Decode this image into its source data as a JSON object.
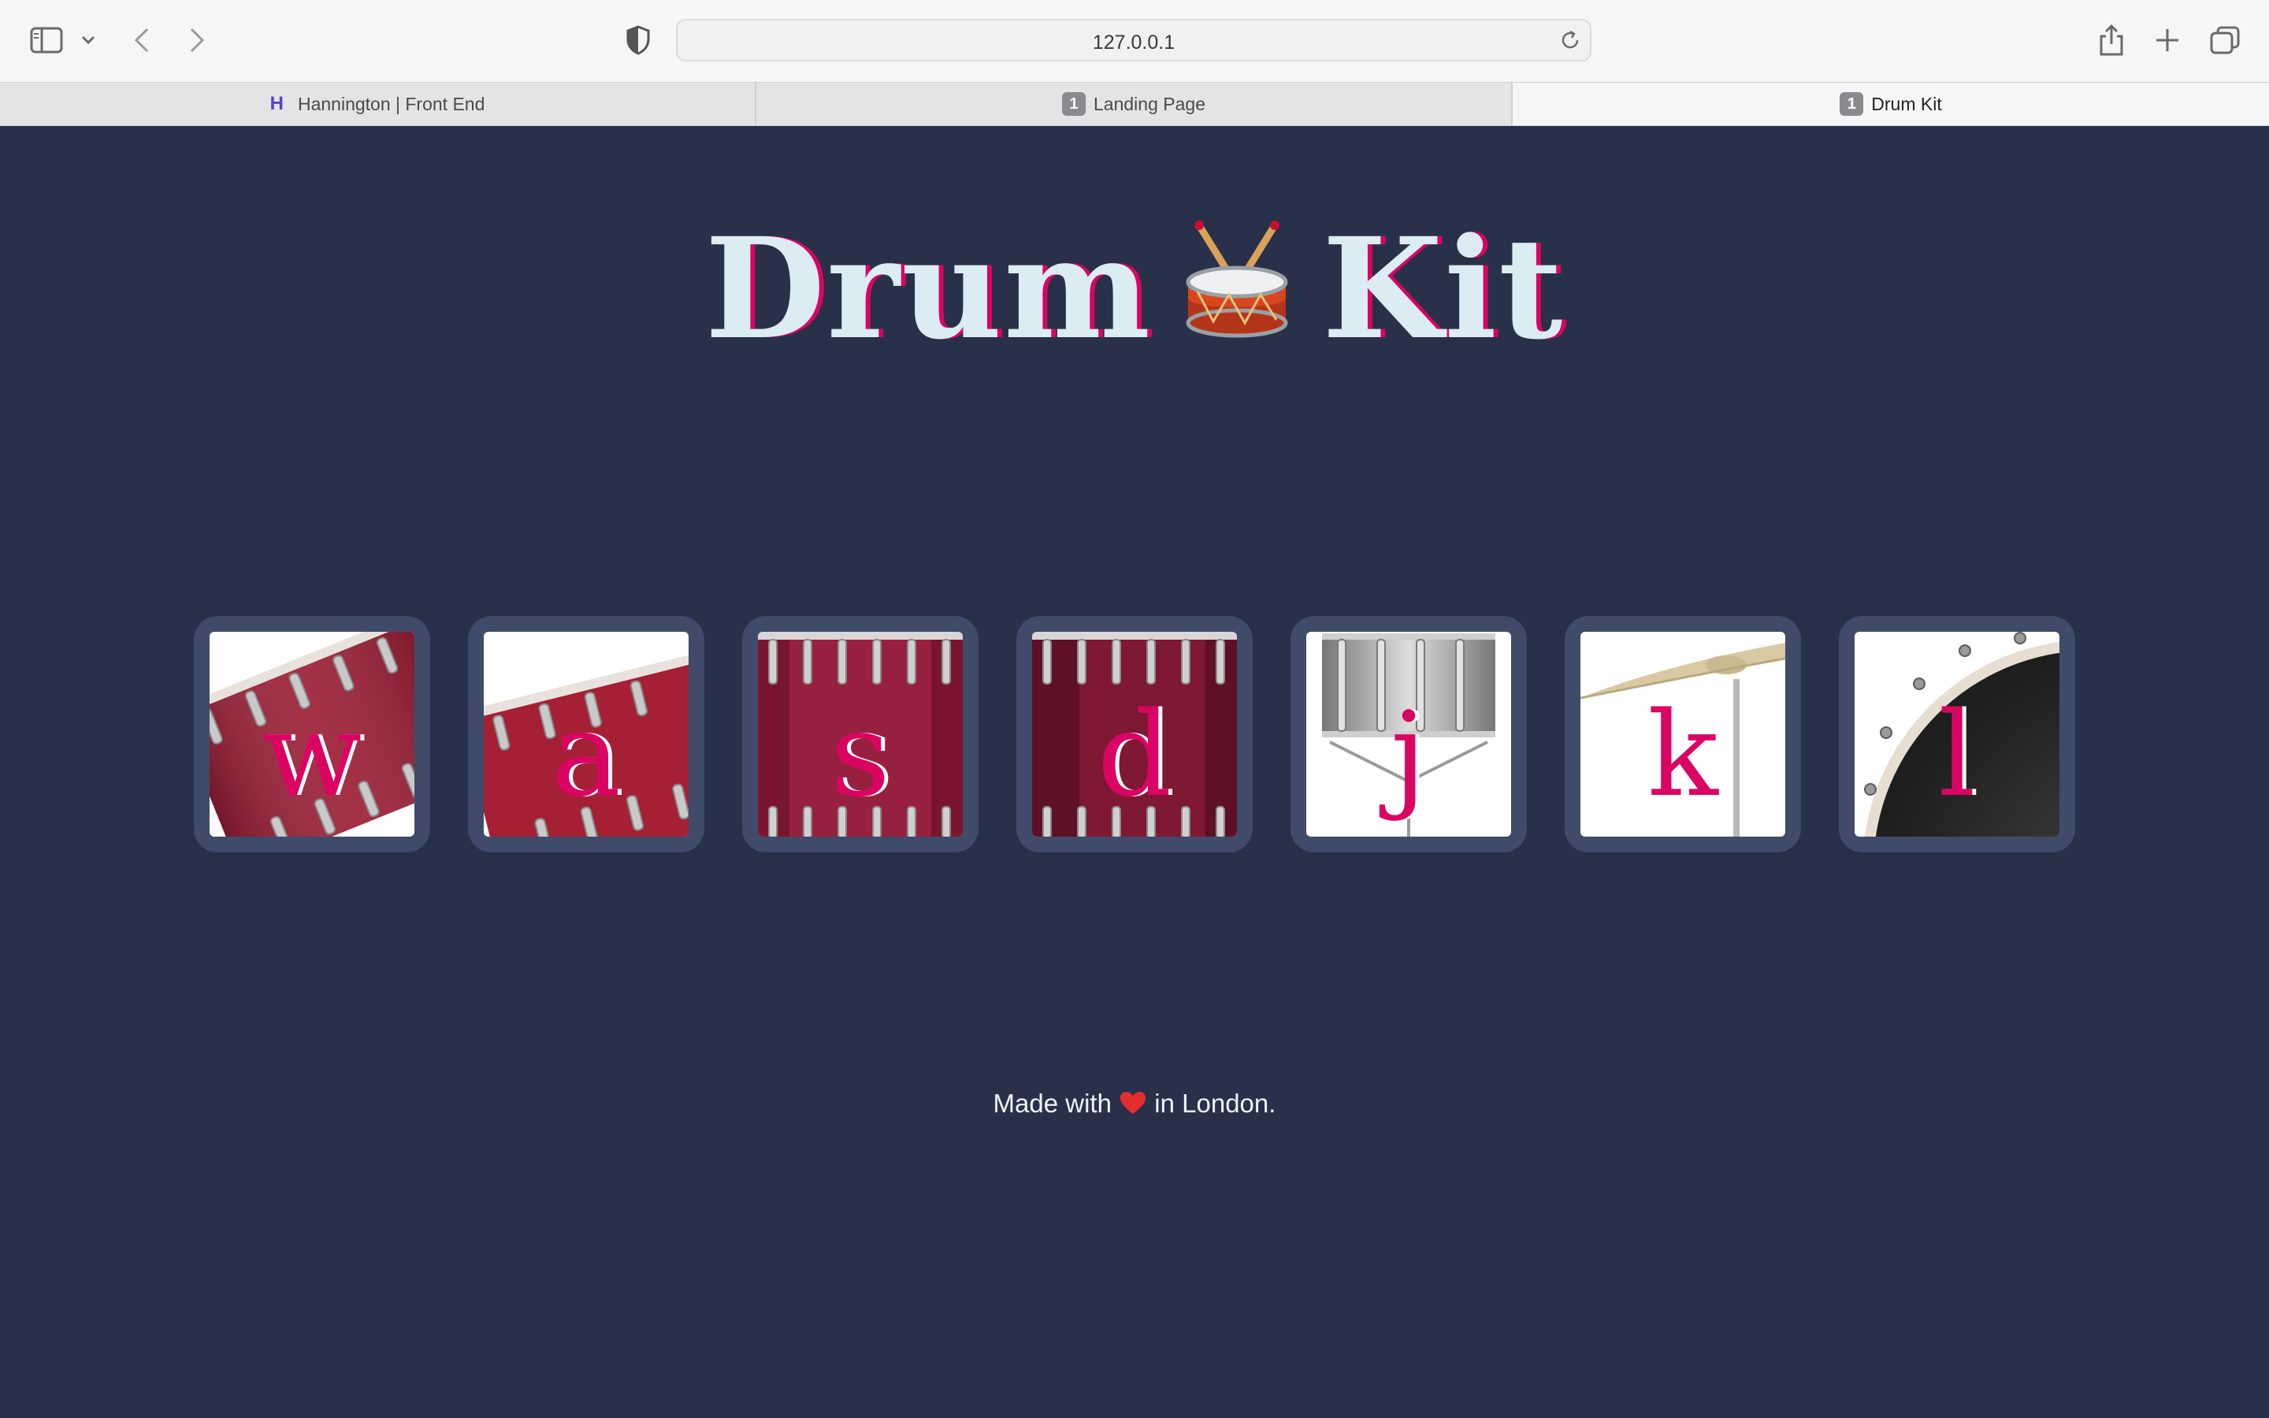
{
  "browser": {
    "url": "127.0.0.1",
    "tabs": [
      {
        "label": "Hannington | Front End",
        "favicon": "H",
        "active": false
      },
      {
        "label": "Landing Page",
        "favicon": "1",
        "active": false
      },
      {
        "label": "Drum Kit",
        "favicon": "1",
        "active": true
      }
    ],
    "icons": [
      "sidebar-icon",
      "chevron-down-icon",
      "back-arrow-icon",
      "forward-arrow-icon",
      "shield-icon",
      "reload-icon",
      "share-icon",
      "new-tab-icon",
      "tab-overview-icon"
    ]
  },
  "page": {
    "title_left": "Drum",
    "title_emoji": "🥁",
    "title_right": "Kit",
    "pads": [
      {
        "key": "w",
        "image": "red-tom-drum-tilted"
      },
      {
        "key": "a",
        "image": "red-tom-drum-tilted"
      },
      {
        "key": "s",
        "image": "red-floor-tom"
      },
      {
        "key": "d",
        "image": "red-floor-tom"
      },
      {
        "key": "j",
        "image": "snare-drum"
      },
      {
        "key": "k",
        "image": "crash-cymbal"
      },
      {
        "key": "l",
        "image": "bass-drum"
      }
    ],
    "footer_before": "Made with",
    "footer_heart": "❤️",
    "footer_after": "in London."
  },
  "colors": {
    "background": "#283149",
    "pad_frame": "#404b69",
    "accent": "#da0463",
    "title_text": "#dbedf3"
  }
}
